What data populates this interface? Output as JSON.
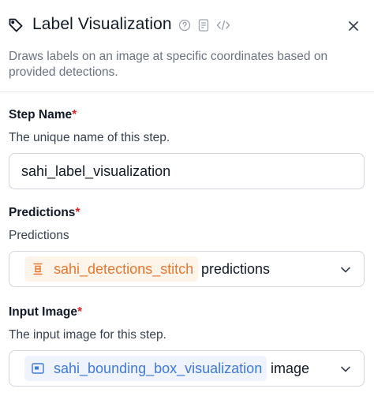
{
  "header": {
    "title": "Label Visualization",
    "icons": [
      "tag-icon",
      "help-icon",
      "document-icon",
      "code-icon",
      "close-icon"
    ]
  },
  "description": "Draws labels on an image at specific coordinates based on provided detections.",
  "fields": {
    "step_name": {
      "label": "Step Name",
      "required_mark": "*",
      "help": "The unique name of this step.",
      "value": "sahi_label_visualization"
    },
    "predictions": {
      "label": "Predictions",
      "required_mark": "*",
      "help": "Predictions",
      "selected_step": "sahi_detections_stitch",
      "selected_output": "predictions",
      "chip_icon": "stitch-icon"
    },
    "input_image": {
      "label": "Input Image",
      "required_mark": "*",
      "help": "The input image for this step.",
      "selected_step": "sahi_bounding_box_visualization",
      "selected_output": "image",
      "chip_icon": "image-icon"
    }
  },
  "colors": {
    "required": "#dc2626",
    "orange_chip_text": "#e8772e",
    "orange_chip_bg": "#fff4ea",
    "blue_chip_text": "#3f7ad9",
    "blue_chip_bg": "#eef3fd"
  }
}
